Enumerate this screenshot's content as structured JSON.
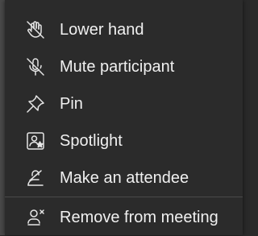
{
  "menu": {
    "items": [
      {
        "label": "Lower hand",
        "icon": "lower-hand-icon"
      },
      {
        "label": "Mute participant",
        "icon": "mute-microphone-icon"
      },
      {
        "label": "Pin",
        "icon": "pin-icon"
      },
      {
        "label": "Spotlight",
        "icon": "spotlight-icon"
      },
      {
        "label": "Make an attendee",
        "icon": "make-attendee-icon"
      },
      {
        "label": "Remove from meeting",
        "icon": "remove-person-icon"
      }
    ]
  },
  "colors": {
    "menu_background": "#2b2b2b",
    "text": "#f0f0f0",
    "icon": "#e6e6e6",
    "divider": "#4a4a4a"
  }
}
